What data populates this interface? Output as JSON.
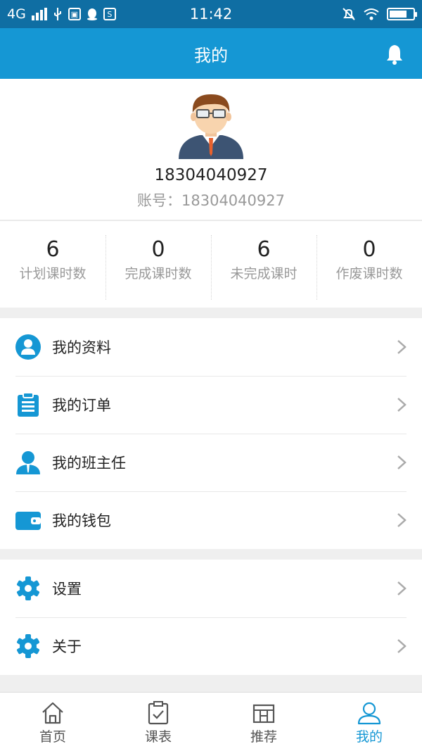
{
  "status_bar": {
    "network": "4G",
    "time": "11:42"
  },
  "header": {
    "title": "我的"
  },
  "profile": {
    "phone": "18304040927",
    "account_label": "账号：",
    "account_value": "18304040927"
  },
  "stats": [
    {
      "value": "6",
      "label": "计划课时数"
    },
    {
      "value": "0",
      "label": "完成课时数"
    },
    {
      "value": "6",
      "label": "未完成课时"
    },
    {
      "value": "0",
      "label": "作废课时数"
    }
  ],
  "menu_group_1": [
    {
      "label": "我的资料",
      "icon": "profile-icon"
    },
    {
      "label": "我的订单",
      "icon": "clipboard-icon"
    },
    {
      "label": "我的班主任",
      "icon": "teacher-icon"
    },
    {
      "label": "我的钱包",
      "icon": "wallet-icon"
    }
  ],
  "menu_group_2": [
    {
      "label": "设置",
      "icon": "gear-icon"
    },
    {
      "label": "关于",
      "icon": "gear-icon"
    }
  ],
  "tabs": [
    {
      "label": "首页",
      "icon": "home-icon"
    },
    {
      "label": "课表",
      "icon": "schedule-icon"
    },
    {
      "label": "推荐",
      "icon": "recommend-icon"
    },
    {
      "label": "我的",
      "icon": "user-icon",
      "active": true
    }
  ],
  "colors": {
    "header": "#1597d4",
    "status_bar": "#0f6ea3",
    "icon": "#1597d4",
    "active_tab": "#1597d4"
  }
}
